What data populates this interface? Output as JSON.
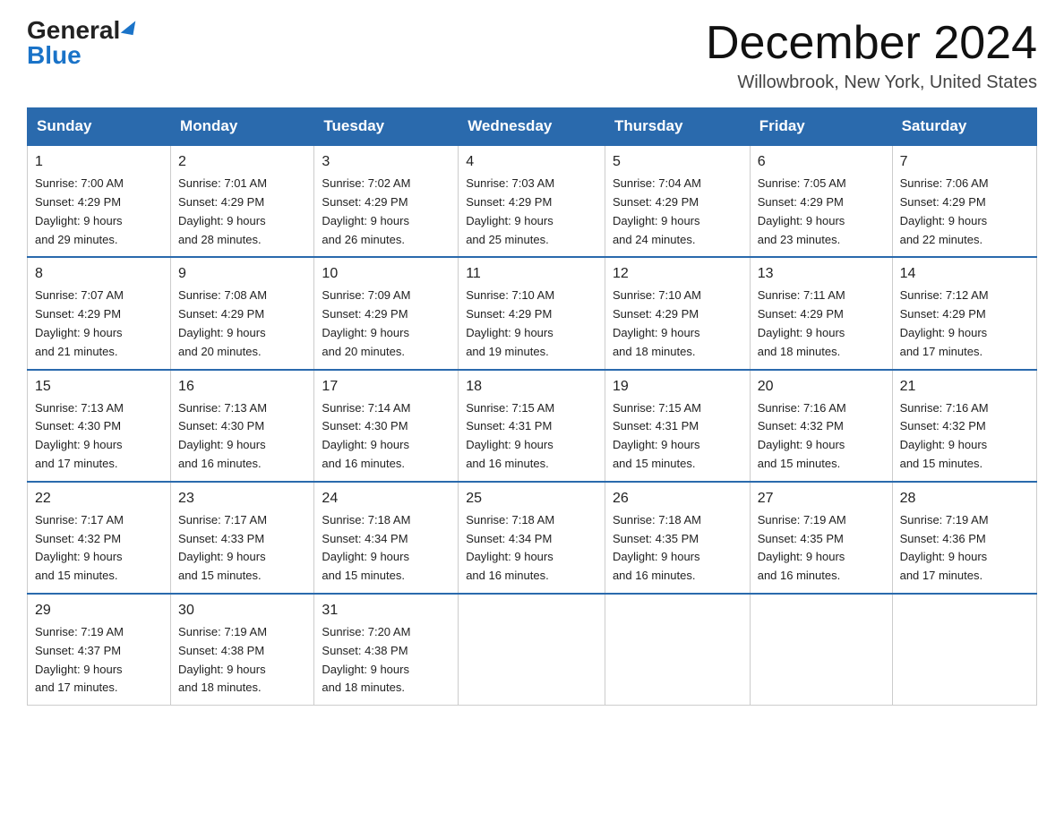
{
  "header": {
    "logo_general": "General",
    "logo_blue": "Blue",
    "month_title": "December 2024",
    "location": "Willowbrook, New York, United States"
  },
  "days_of_week": [
    "Sunday",
    "Monday",
    "Tuesday",
    "Wednesday",
    "Thursday",
    "Friday",
    "Saturday"
  ],
  "weeks": [
    [
      {
        "day": "1",
        "sunrise": "7:00 AM",
        "sunset": "4:29 PM",
        "daylight": "9 hours and 29 minutes."
      },
      {
        "day": "2",
        "sunrise": "7:01 AM",
        "sunset": "4:29 PM",
        "daylight": "9 hours and 28 minutes."
      },
      {
        "day": "3",
        "sunrise": "7:02 AM",
        "sunset": "4:29 PM",
        "daylight": "9 hours and 26 minutes."
      },
      {
        "day": "4",
        "sunrise": "7:03 AM",
        "sunset": "4:29 PM",
        "daylight": "9 hours and 25 minutes."
      },
      {
        "day": "5",
        "sunrise": "7:04 AM",
        "sunset": "4:29 PM",
        "daylight": "9 hours and 24 minutes."
      },
      {
        "day": "6",
        "sunrise": "7:05 AM",
        "sunset": "4:29 PM",
        "daylight": "9 hours and 23 minutes."
      },
      {
        "day": "7",
        "sunrise": "7:06 AM",
        "sunset": "4:29 PM",
        "daylight": "9 hours and 22 minutes."
      }
    ],
    [
      {
        "day": "8",
        "sunrise": "7:07 AM",
        "sunset": "4:29 PM",
        "daylight": "9 hours and 21 minutes."
      },
      {
        "day": "9",
        "sunrise": "7:08 AM",
        "sunset": "4:29 PM",
        "daylight": "9 hours and 20 minutes."
      },
      {
        "day": "10",
        "sunrise": "7:09 AM",
        "sunset": "4:29 PM",
        "daylight": "9 hours and 20 minutes."
      },
      {
        "day": "11",
        "sunrise": "7:10 AM",
        "sunset": "4:29 PM",
        "daylight": "9 hours and 19 minutes."
      },
      {
        "day": "12",
        "sunrise": "7:10 AM",
        "sunset": "4:29 PM",
        "daylight": "9 hours and 18 minutes."
      },
      {
        "day": "13",
        "sunrise": "7:11 AM",
        "sunset": "4:29 PM",
        "daylight": "9 hours and 18 minutes."
      },
      {
        "day": "14",
        "sunrise": "7:12 AM",
        "sunset": "4:29 PM",
        "daylight": "9 hours and 17 minutes."
      }
    ],
    [
      {
        "day": "15",
        "sunrise": "7:13 AM",
        "sunset": "4:30 PM",
        "daylight": "9 hours and 17 minutes."
      },
      {
        "day": "16",
        "sunrise": "7:13 AM",
        "sunset": "4:30 PM",
        "daylight": "9 hours and 16 minutes."
      },
      {
        "day": "17",
        "sunrise": "7:14 AM",
        "sunset": "4:30 PM",
        "daylight": "9 hours and 16 minutes."
      },
      {
        "day": "18",
        "sunrise": "7:15 AM",
        "sunset": "4:31 PM",
        "daylight": "9 hours and 16 minutes."
      },
      {
        "day": "19",
        "sunrise": "7:15 AM",
        "sunset": "4:31 PM",
        "daylight": "9 hours and 15 minutes."
      },
      {
        "day": "20",
        "sunrise": "7:16 AM",
        "sunset": "4:32 PM",
        "daylight": "9 hours and 15 minutes."
      },
      {
        "day": "21",
        "sunrise": "7:16 AM",
        "sunset": "4:32 PM",
        "daylight": "9 hours and 15 minutes."
      }
    ],
    [
      {
        "day": "22",
        "sunrise": "7:17 AM",
        "sunset": "4:32 PM",
        "daylight": "9 hours and 15 minutes."
      },
      {
        "day": "23",
        "sunrise": "7:17 AM",
        "sunset": "4:33 PM",
        "daylight": "9 hours and 15 minutes."
      },
      {
        "day": "24",
        "sunrise": "7:18 AM",
        "sunset": "4:34 PM",
        "daylight": "9 hours and 15 minutes."
      },
      {
        "day": "25",
        "sunrise": "7:18 AM",
        "sunset": "4:34 PM",
        "daylight": "9 hours and 16 minutes."
      },
      {
        "day": "26",
        "sunrise": "7:18 AM",
        "sunset": "4:35 PM",
        "daylight": "9 hours and 16 minutes."
      },
      {
        "day": "27",
        "sunrise": "7:19 AM",
        "sunset": "4:35 PM",
        "daylight": "9 hours and 16 minutes."
      },
      {
        "day": "28",
        "sunrise": "7:19 AM",
        "sunset": "4:36 PM",
        "daylight": "9 hours and 17 minutes."
      }
    ],
    [
      {
        "day": "29",
        "sunrise": "7:19 AM",
        "sunset": "4:37 PM",
        "daylight": "9 hours and 17 minutes."
      },
      {
        "day": "30",
        "sunrise": "7:19 AM",
        "sunset": "4:38 PM",
        "daylight": "9 hours and 18 minutes."
      },
      {
        "day": "31",
        "sunrise": "7:20 AM",
        "sunset": "4:38 PM",
        "daylight": "9 hours and 18 minutes."
      },
      null,
      null,
      null,
      null
    ]
  ],
  "labels": {
    "sunrise": "Sunrise:",
    "sunset": "Sunset:",
    "daylight": "Daylight:"
  }
}
